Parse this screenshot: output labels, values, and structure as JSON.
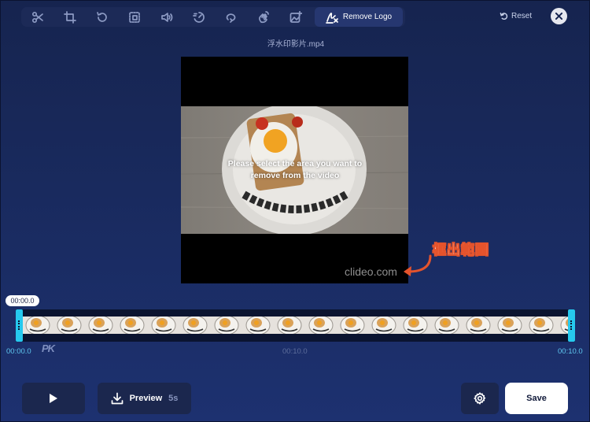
{
  "toolbar": {
    "tools": [
      {
        "name": "scissors-icon"
      },
      {
        "name": "crop-icon"
      },
      {
        "name": "rotate-icon"
      },
      {
        "name": "resize-icon"
      },
      {
        "name": "volume-icon"
      },
      {
        "name": "speed-icon"
      },
      {
        "name": "loop-icon"
      },
      {
        "name": "hand-wave-icon"
      },
      {
        "name": "image-add-icon"
      }
    ],
    "active_tool": {
      "icon": "remove-logo-icon",
      "label": "Remove Logo"
    }
  },
  "header": {
    "reset_label": "Reset",
    "file_name": "浮水印影片.mp4"
  },
  "video": {
    "instruction": "Please select the area you want to remove from the video",
    "watermark": "clideo.com"
  },
  "annotation": {
    "label": "框出範圍",
    "color": "#e4532c"
  },
  "timeline": {
    "current_time": "00:00.0",
    "start_label": "00:00.0",
    "mid_label": "00:10.0",
    "end_label": "00:10.0",
    "handle_color": "#26c9ee",
    "logo_text": "PK"
  },
  "controls": {
    "preview_label": "Preview",
    "preview_duration": "5s",
    "save_label": "Save"
  },
  "colors": {
    "background": "#1a2c63",
    "panel": "#1b274e",
    "accent": "#26c9ee"
  }
}
